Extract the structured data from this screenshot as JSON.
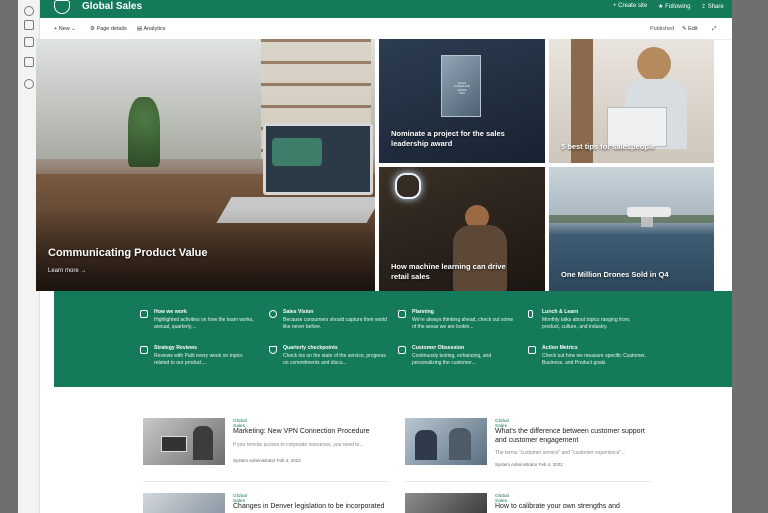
{
  "suitebar": {
    "site_title": "Global Sales",
    "actions": [
      {
        "icon": "plus-icon",
        "label": "Create site"
      },
      {
        "icon": "star-icon",
        "label": "Following"
      },
      {
        "icon": "share-icon",
        "label": "Share"
      }
    ]
  },
  "commandbar": {
    "new_label": "New",
    "page_details_label": "Page details",
    "analytics_label": "Analytics",
    "status_label": "Published",
    "edit_label": "Edit"
  },
  "hero": {
    "main": {
      "title": "Communicating Product Value",
      "link": "Learn more"
    },
    "tiles": [
      {
        "title": "Nominate a project for the sales leadership award"
      },
      {
        "title": "5 best tips for salespeople"
      },
      {
        "title": "How machine learning can drive retail sales"
      },
      {
        "title": "One Million Drones Sold in Q4"
      }
    ],
    "award_text": [
      "SALES",
      "LEADERSHIP",
      "AWARD",
      "2024"
    ]
  },
  "quick_links": [
    {
      "icon": "people-icon",
      "title": "How we work",
      "desc": "Highlighted activities on how the team works, annual, quarterly,..."
    },
    {
      "icon": "glasses-icon",
      "title": "Sales Vision",
      "desc": "Because consumers should capture their world like never before."
    },
    {
      "icon": "calendar-icon",
      "title": "Planning",
      "desc": "We're always thinking ahead, check out some of the areas we are lookin..."
    },
    {
      "icon": "fork-knife-icon",
      "title": "Lunch & Learn",
      "desc": "Monthly talks about topics ranging from, product, culture, and industry."
    },
    {
      "icon": "edit-icon",
      "title": "Strategy Reviews",
      "desc": "Reviews with Patti every week on topics related to our product,..."
    },
    {
      "icon": "flask-icon",
      "title": "Quarterly checkpoints",
      "desc": "Check ins on the state of the service, progress on commitments and discu..."
    },
    {
      "icon": "people-icon",
      "title": "Customer Obsession",
      "desc": "Continuosly testing, enhancing, and personalizing the customer..."
    },
    {
      "icon": "chart-icon",
      "title": "Action Metrics",
      "desc": "Check out how we measure specific Customer, Business, and Product goals"
    }
  ],
  "news": [
    {
      "category": "Global Sales",
      "title": "Marketing: New VPN Connection Procedure",
      "excerpt": "If you remote access to corporate resources, you need to...",
      "author": "System Administrator",
      "date": "Feb 4, 2022"
    },
    {
      "category": "Global Sales",
      "title": "What's the difference between customer support and customer engagement",
      "excerpt": "The terms \"customer service\" and \"customer experience\"...",
      "author": "System Administrator",
      "date": "Feb 4, 2022"
    },
    {
      "category": "Global Sales",
      "title": "Changes in Denver legislation to be incorporated",
      "excerpt": "",
      "author": "",
      "date": ""
    },
    {
      "category": "Global Sales",
      "title": "How to calibrate your own strengths and",
      "excerpt": "",
      "author": "",
      "date": ""
    }
  ]
}
